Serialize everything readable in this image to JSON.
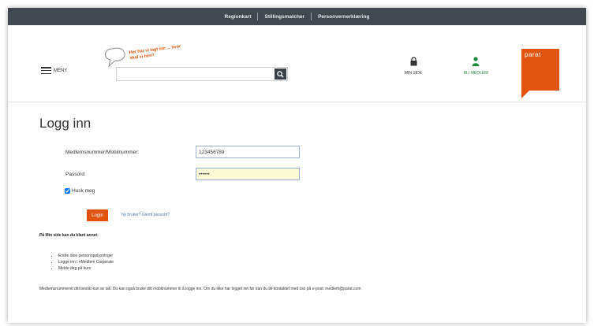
{
  "topnav": {
    "items": [
      "Regionkart",
      "Stillingsmatcher",
      "Personvernerklæring"
    ]
  },
  "header": {
    "menu_label": "MENY",
    "slogan": "Her har vi lagt inn ... hvor skal vi hen?",
    "search_placeholder": "",
    "search_icon": "magnifier-icon",
    "min_side_label": "MIN SIDE",
    "bli_medlem_label": "BLI MEDLEM",
    "logo_text": "parat",
    "colors": {
      "brand": "#e0540f",
      "topbar": "#42484f",
      "member": "#1e8a3a"
    }
  },
  "login": {
    "title": "Logg inn",
    "username_label": "Medlemsnummer/Mobilnummer:",
    "username_value": "123456789",
    "password_label": "Passord:",
    "password_value": "••••••",
    "remember_label": "Husk meg",
    "submit_label": "Login",
    "forgot_label": "Ny bruker? Glemt passord?"
  },
  "info": {
    "heading": "På Min side kan du blant annet:",
    "items": [
      "Endre dine personopplysninger",
      "Logge inn i eMedlem Corporate",
      "Melde deg på kurs"
    ],
    "footer": "Medlemsnummeret ditt består kun av tall. Du kan også bruke ditt mobilnummer til å logge inn. Om du ikke har logget inn før kan du bli kontaktet med oss på e-post: medlem@parat.com"
  }
}
